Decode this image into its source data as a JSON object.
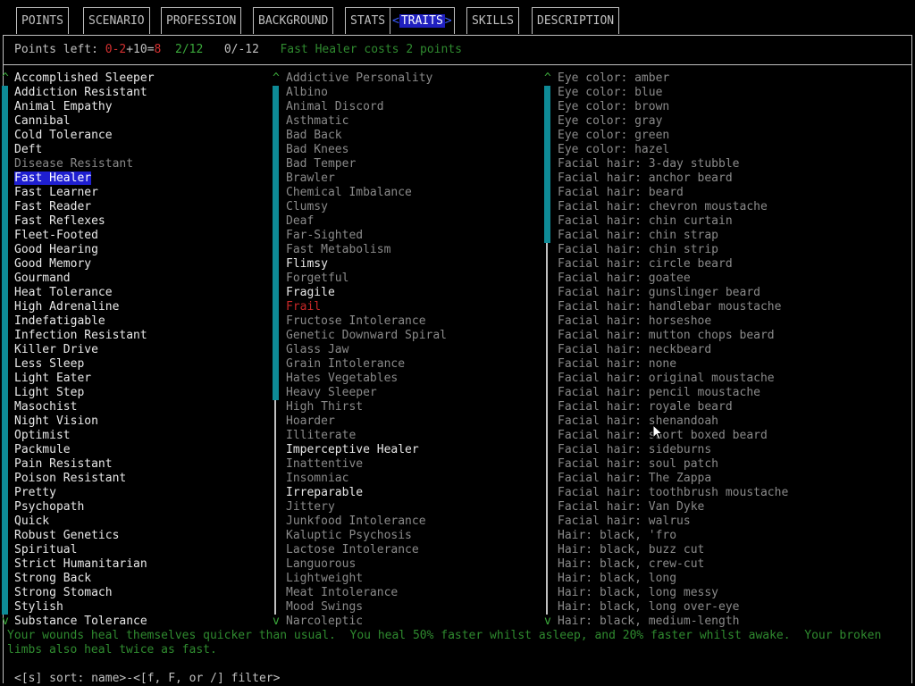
{
  "tabs": {
    "points": "POINTS",
    "scenario": "SCENARIO",
    "profession": "PROFESSION",
    "background": "BACKGROUND",
    "stats": "STATS",
    "traits_left": "<",
    "traits": "TRAITS",
    "traits_right": ">",
    "skills": "SKILLS",
    "description": "DESCRIPTION"
  },
  "status": {
    "points_label": "Points left: ",
    "points_a": "0-2",
    "points_b": "+10=",
    "points_c": "8",
    "positive_count": "2/12",
    "negative_count": "0/-12",
    "message": "Fast Healer costs 2 points"
  },
  "scroll": {
    "up": "^",
    "down": "v"
  },
  "good_traits": [
    {
      "name": "Accomplished Sleeper",
      "style": "bright"
    },
    {
      "name": "Addiction Resistant",
      "style": "bright"
    },
    {
      "name": "Animal Empathy",
      "style": "bright"
    },
    {
      "name": "Cannibal",
      "style": "bright"
    },
    {
      "name": "Cold Tolerance",
      "style": "bright"
    },
    {
      "name": "Deft",
      "style": "bright"
    },
    {
      "name": "Disease Resistant",
      "style": "dim"
    },
    {
      "name": "Fast Healer",
      "style": "selected"
    },
    {
      "name": "Fast Learner",
      "style": "bright"
    },
    {
      "name": "Fast Reader",
      "style": "bright"
    },
    {
      "name": "Fast Reflexes",
      "style": "bright"
    },
    {
      "name": "Fleet-Footed",
      "style": "bright"
    },
    {
      "name": "Good Hearing",
      "style": "bright"
    },
    {
      "name": "Good Memory",
      "style": "bright"
    },
    {
      "name": "Gourmand",
      "style": "bright"
    },
    {
      "name": "Heat Tolerance",
      "style": "bright"
    },
    {
      "name": "High Adrenaline",
      "style": "bright"
    },
    {
      "name": "Indefatigable",
      "style": "bright"
    },
    {
      "name": "Infection Resistant",
      "style": "bright"
    },
    {
      "name": "Killer Drive",
      "style": "bright"
    },
    {
      "name": "Less Sleep",
      "style": "bright"
    },
    {
      "name": "Light Eater",
      "style": "bright"
    },
    {
      "name": "Light Step",
      "style": "bright"
    },
    {
      "name": "Masochist",
      "style": "bright"
    },
    {
      "name": "Night Vision",
      "style": "bright"
    },
    {
      "name": "Optimist",
      "style": "bright"
    },
    {
      "name": "Packmule",
      "style": "bright"
    },
    {
      "name": "Pain Resistant",
      "style": "bright"
    },
    {
      "name": "Poison Resistant",
      "style": "bright"
    },
    {
      "name": "Pretty",
      "style": "bright"
    },
    {
      "name": "Psychopath",
      "style": "bright"
    },
    {
      "name": "Quick",
      "style": "bright"
    },
    {
      "name": "Robust Genetics",
      "style": "bright"
    },
    {
      "name": "Spiritual",
      "style": "bright"
    },
    {
      "name": "Strict Humanitarian",
      "style": "bright"
    },
    {
      "name": "Strong Back",
      "style": "bright"
    },
    {
      "name": "Strong Stomach",
      "style": "bright"
    },
    {
      "name": "Stylish",
      "style": "bright"
    },
    {
      "name": "Substance Tolerance",
      "style": "bright"
    }
  ],
  "bad_traits": [
    {
      "name": "Addictive Personality",
      "style": "dim"
    },
    {
      "name": "Albino",
      "style": "dim"
    },
    {
      "name": "Animal Discord",
      "style": "dim"
    },
    {
      "name": "Asthmatic",
      "style": "dim"
    },
    {
      "name": "Bad Back",
      "style": "dim"
    },
    {
      "name": "Bad Knees",
      "style": "dim"
    },
    {
      "name": "Bad Temper",
      "style": "dim"
    },
    {
      "name": "Brawler",
      "style": "dim"
    },
    {
      "name": "Chemical Imbalance",
      "style": "dim"
    },
    {
      "name": "Clumsy",
      "style": "dim"
    },
    {
      "name": "Deaf",
      "style": "dim"
    },
    {
      "name": "Far-Sighted",
      "style": "dim"
    },
    {
      "name": "Fast Metabolism",
      "style": "dim"
    },
    {
      "name": "Flimsy",
      "style": "bright"
    },
    {
      "name": "Forgetful",
      "style": "dim"
    },
    {
      "name": "Fragile",
      "style": "bright"
    },
    {
      "name": "Frail",
      "style": "frail"
    },
    {
      "name": "Fructose Intolerance",
      "style": "dim"
    },
    {
      "name": "Genetic Downward Spiral",
      "style": "dim"
    },
    {
      "name": "Glass Jaw",
      "style": "dim"
    },
    {
      "name": "Grain Intolerance",
      "style": "dim"
    },
    {
      "name": "Hates Vegetables",
      "style": "dim"
    },
    {
      "name": "Heavy Sleeper",
      "style": "dim"
    },
    {
      "name": "High Thirst",
      "style": "dim"
    },
    {
      "name": "Hoarder",
      "style": "dim"
    },
    {
      "name": "Illiterate",
      "style": "dim"
    },
    {
      "name": "Imperceptive Healer",
      "style": "bright"
    },
    {
      "name": "Inattentive",
      "style": "dim"
    },
    {
      "name": "Insomniac",
      "style": "dim"
    },
    {
      "name": "Irreparable",
      "style": "bright"
    },
    {
      "name": "Jittery",
      "style": "dim"
    },
    {
      "name": "Junkfood Intolerance",
      "style": "dim"
    },
    {
      "name": "Kaluptic Psychosis",
      "style": "dim"
    },
    {
      "name": "Lactose Intolerance",
      "style": "dim"
    },
    {
      "name": "Languorous",
      "style": "dim"
    },
    {
      "name": "Lightweight",
      "style": "dim"
    },
    {
      "name": "Meat Intolerance",
      "style": "dim"
    },
    {
      "name": "Mood Swings",
      "style": "dim"
    },
    {
      "name": "Narcoleptic",
      "style": "dim"
    }
  ],
  "neutral_traits": [
    {
      "name": "Eye color: amber",
      "style": "dim"
    },
    {
      "name": "Eye color: blue",
      "style": "dim"
    },
    {
      "name": "Eye color: brown",
      "style": "dim"
    },
    {
      "name": "Eye color: gray",
      "style": "dim"
    },
    {
      "name": "Eye color: green",
      "style": "dim"
    },
    {
      "name": "Eye color: hazel",
      "style": "dim"
    },
    {
      "name": "Facial hair: 3-day stubble",
      "style": "dim"
    },
    {
      "name": "Facial hair: anchor beard",
      "style": "dim"
    },
    {
      "name": "Facial hair: beard",
      "style": "dim"
    },
    {
      "name": "Facial hair: chevron moustache",
      "style": "dim"
    },
    {
      "name": "Facial hair: chin curtain",
      "style": "dim"
    },
    {
      "name": "Facial hair: chin strap",
      "style": "dim"
    },
    {
      "name": "Facial hair: chin strip",
      "style": "dim"
    },
    {
      "name": "Facial hair: circle beard",
      "style": "dim"
    },
    {
      "name": "Facial hair: goatee",
      "style": "dim"
    },
    {
      "name": "Facial hair: gunslinger beard",
      "style": "dim"
    },
    {
      "name": "Facial hair: handlebar moustache",
      "style": "dim"
    },
    {
      "name": "Facial hair: horseshoe",
      "style": "dim"
    },
    {
      "name": "Facial hair: mutton chops beard",
      "style": "dim"
    },
    {
      "name": "Facial hair: neckbeard",
      "style": "dim"
    },
    {
      "name": "Facial hair: none",
      "style": "dim"
    },
    {
      "name": "Facial hair: original moustache",
      "style": "dim"
    },
    {
      "name": "Facial hair: pencil moustache",
      "style": "dim"
    },
    {
      "name": "Facial hair: royale beard",
      "style": "dim"
    },
    {
      "name": "Facial hair: shenandoah",
      "style": "dim"
    },
    {
      "name": "Facial hair: short boxed beard",
      "style": "dim"
    },
    {
      "name": "Facial hair: sideburns",
      "style": "dim"
    },
    {
      "name": "Facial hair: soul patch",
      "style": "dim"
    },
    {
      "name": "Facial hair: The Zappa",
      "style": "dim"
    },
    {
      "name": "Facial hair: toothbrush moustache",
      "style": "dim"
    },
    {
      "name": "Facial hair: Van Dyke",
      "style": "dim"
    },
    {
      "name": "Facial hair: walrus",
      "style": "dim"
    },
    {
      "name": "Hair: black, 'fro",
      "style": "dim"
    },
    {
      "name": "Hair: black, buzz cut",
      "style": "dim"
    },
    {
      "name": "Hair: black, crew-cut",
      "style": "dim"
    },
    {
      "name": "Hair: black, long",
      "style": "dim"
    },
    {
      "name": "Hair: black, long messy",
      "style": "dim"
    },
    {
      "name": "Hair: black, long over-eye",
      "style": "dim"
    },
    {
      "name": "Hair: black, medium-length",
      "style": "dim"
    }
  ],
  "description": "Your wounds heal themselves quicker than usual.  You heal 50% faster whilst asleep, and 20% faster whilst awake.  Your broken limbs also heal twice as fast.",
  "footer": {
    "sort": "<[s] sort: name>",
    "sep": "-",
    "filter": "<[f, F, or /] filter>"
  },
  "colors": {
    "selected_bg": "#1f1fd0",
    "scrollbar": "#0e8a96",
    "positive": "#3aa83a",
    "negative": "#d23030"
  }
}
